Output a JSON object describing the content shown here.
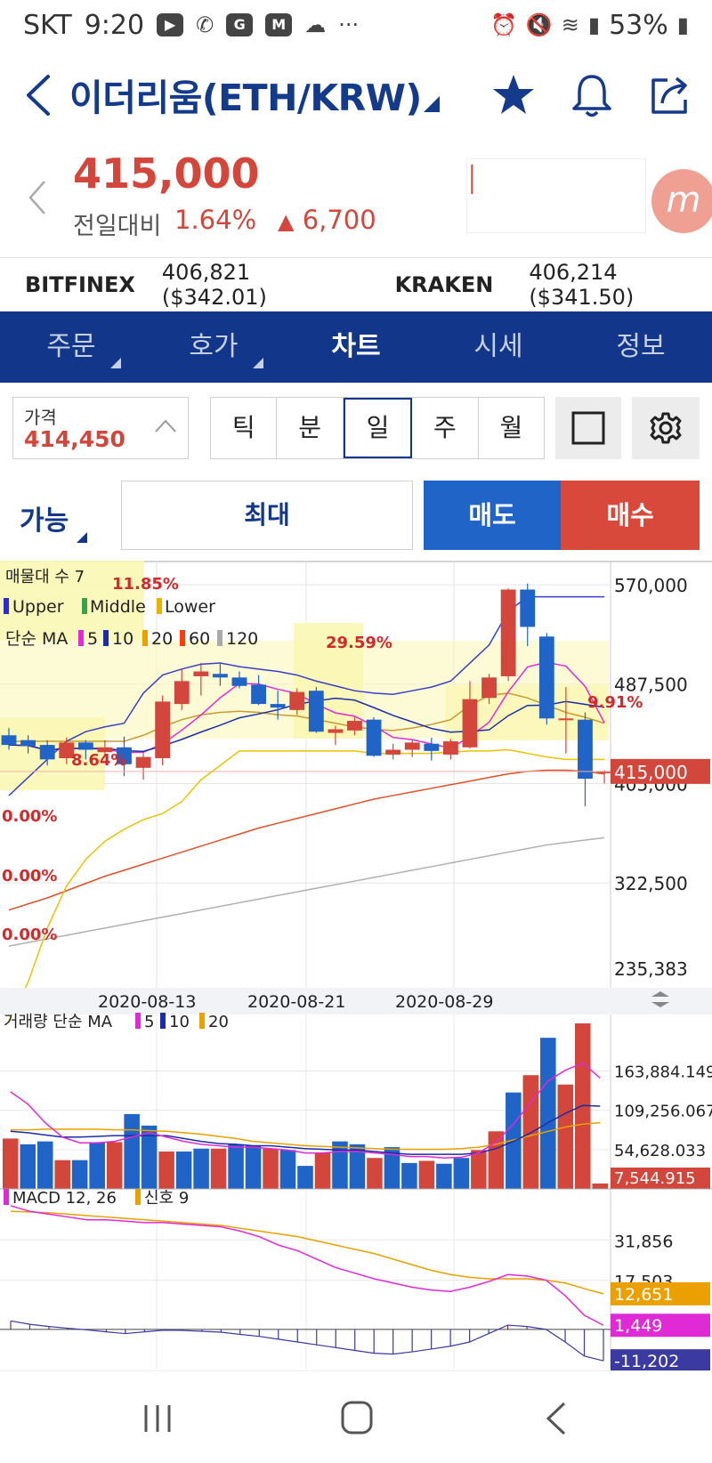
{
  "status_bar": {
    "carrier": "SKT",
    "time": "9:20",
    "battery": "53%"
  },
  "header": {
    "title": "이더리움(ETH/KRW)"
  },
  "price": {
    "current": "415,000",
    "change_label": "전일대비",
    "change_pct": "1.64%",
    "change_val": "6,700",
    "logo_letter": "m"
  },
  "exchanges": [
    {
      "name": "BITFINEX",
      "value": "406,821 ($342.01)"
    },
    {
      "name": "KRAKEN",
      "value": "406,214 ($341.50)"
    }
  ],
  "tabs": [
    "주문",
    "호가",
    "차트",
    "시세",
    "정보"
  ],
  "price_box": {
    "label": "가격",
    "value": "414,450"
  },
  "periods": [
    "틱",
    "분",
    "일",
    "주",
    "월"
  ],
  "order": {
    "available": "가능",
    "max": "최대",
    "sell": "매도",
    "buy": "매수"
  },
  "colors": {
    "brand": "#12378a",
    "up": "#d2463b",
    "down": "#2064c7",
    "sell": "#2064c7",
    "buy": "#d8493c"
  },
  "chart_data": [
    {
      "type": "candlestick",
      "title": "",
      "indicators": {
        "volume_profile": "매물대 수 7",
        "bollinger": [
          "Upper",
          "Middle",
          "Lower"
        ],
        "ma_label": "단순 MA",
        "ma_periods": [
          "5",
          "10",
          "20",
          "60",
          "120"
        ]
      },
      "y_ticks": [
        "570,000",
        "487,500",
        "405,000",
        "322,500",
        "235,383"
      ],
      "current_price_label": "415,000",
      "x_ticks": [
        "2020-08-13",
        "2020-08-21",
        "2020-08-29"
      ],
      "volume_profile_pcts": [
        "11.85%",
        "29.59%",
        "9.91%",
        "8.64%",
        "0.00%",
        "0.00%",
        "0.00%"
      ],
      "ohlc": [
        [
          445000,
          451000,
          433000,
          437000
        ],
        [
          441000,
          445000,
          430000,
          436000
        ],
        [
          437000,
          441000,
          420000,
          425000
        ],
        [
          426000,
          443000,
          421000,
          439000
        ],
        [
          439000,
          441000,
          425000,
          433000
        ],
        [
          431000,
          441000,
          428000,
          435000
        ],
        [
          435000,
          444000,
          411000,
          421000
        ],
        [
          418000,
          431000,
          408000,
          427000
        ],
        [
          426000,
          478000,
          420000,
          473000
        ],
        [
          471000,
          500000,
          466000,
          490000
        ],
        [
          494000,
          505000,
          478000,
          498000
        ],
        [
          496000,
          505000,
          486000,
          493000
        ],
        [
          493000,
          498000,
          484000,
          486000
        ],
        [
          487000,
          495000,
          470000,
          471000
        ],
        [
          471000,
          482000,
          458000,
          468000
        ],
        [
          466000,
          484000,
          462000,
          481000
        ],
        [
          482000,
          485000,
          447000,
          448000
        ],
        [
          447000,
          453000,
          437000,
          450000
        ],
        [
          449000,
          460000,
          445000,
          457000
        ],
        [
          458000,
          460000,
          427000,
          428000
        ],
        [
          429000,
          438000,
          425000,
          433000
        ],
        [
          433000,
          441000,
          427000,
          439000
        ],
        [
          438000,
          443000,
          424000,
          432000
        ],
        [
          429000,
          442000,
          425000,
          440000
        ],
        [
          435000,
          490000,
          434000,
          475000
        ],
        [
          476000,
          496000,
          471000,
          493000
        ],
        [
          494000,
          567000,
          490000,
          566000
        ],
        [
          566000,
          571000,
          519000,
          535000
        ],
        [
          527000,
          530000,
          454000,
          459000
        ],
        [
          458000,
          485000,
          430000,
          459000
        ],
        [
          458000,
          464000,
          386000,
          409000
        ],
        [
          414000,
          416000,
          405000,
          415000
        ]
      ],
      "bollinger_upper": [
        395000,
        410000,
        425000,
        440000,
        448000,
        452000,
        455000,
        480000,
        495000,
        500000,
        504000,
        505000,
        502000,
        500000,
        498000,
        495000,
        490000,
        486000,
        482000,
        480000,
        479000,
        482000,
        485000,
        490000,
        505000,
        520000,
        548000,
        560000,
        560000,
        560000,
        560000,
        560000
      ],
      "bollinger_middle": [
        440000,
        440000,
        440000,
        440000,
        440000,
        440000,
        440000,
        445000,
        452000,
        458000,
        462000,
        464000,
        465000,
        464000,
        462000,
        461000,
        458000,
        455000,
        452000,
        450000,
        449000,
        451000,
        454000,
        458000,
        470000,
        478000,
        480000,
        476000,
        470000,
        464000,
        460000,
        455000
      ],
      "bollinger_lower": [
        208000,
        240000,
        285000,
        320000,
        342000,
        357000,
        367000,
        375000,
        380000,
        390000,
        408000,
        420000,
        432000,
        432000,
        432000,
        432000,
        432000,
        432000,
        432000,
        430000,
        430000,
        430000,
        430000,
        431000,
        432000,
        432000,
        433000,
        430000,
        427000,
        425000,
        425000,
        425000
      ],
      "ma_red": [
        300000,
        305000,
        310000,
        316000,
        322000,
        328000,
        333000,
        338000,
        343000,
        348000,
        353000,
        358000,
        363000,
        368000,
        372000,
        376000,
        380000,
        384000,
        388000,
        392000,
        395000,
        398000,
        401000,
        404000,
        407000,
        410000,
        413000,
        415000,
        416000,
        416000,
        415000,
        413000
      ],
      "ma_gray": [
        270000,
        273000,
        276000,
        279000,
        282000,
        285000,
        288000,
        291000,
        294000,
        297000,
        300000,
        303000,
        306000,
        309000,
        312000,
        315000,
        318000,
        321000,
        324000,
        327000,
        330000,
        333000,
        336000,
        339000,
        342000,
        345000,
        348000,
        351000,
        354000,
        356000,
        358000,
        360000
      ]
    },
    {
      "type": "bar",
      "title": "",
      "legend_label": "거래량 단순 MA",
      "ma_periods": [
        "5",
        "10",
        "20"
      ],
      "y_ticks": [
        "163,884.149",
        "109,256.067",
        "54,628.033"
      ],
      "last_value_label": "7,544.915",
      "values": [
        70000,
        62000,
        66000,
        40000,
        40000,
        65000,
        65000,
        104000,
        88000,
        52000,
        52000,
        56000,
        56000,
        62000,
        60000,
        56000,
        54000,
        32000,
        50000,
        66000,
        62000,
        43000,
        58000,
        36000,
        39000,
        35000,
        43000,
        54000,
        80000,
        134000,
        158000,
        210000,
        145000,
        230000,
        7544.915
      ],
      "ma5": [
        135000,
        118000,
        92000,
        72000,
        64000,
        64000,
        66000,
        72000,
        78000,
        72000,
        66000,
        62000,
        60000,
        58000,
        58000,
        56000,
        54000,
        50000,
        50000,
        52000,
        52000,
        50000,
        48000,
        45000,
        45000,
        43000,
        44000,
        50000,
        65000,
        90000,
        120000,
        150000,
        165000,
        175000,
        154000
      ],
      "ma10": [
        80000,
        78000,
        75000,
        72000,
        72000,
        73000,
        74000,
        74000,
        74000,
        74000,
        70000,
        66000,
        63000,
        62000,
        60000,
        60000,
        58000,
        56000,
        55000,
        54000,
        54000,
        52000,
        50000,
        48000,
        48000,
        48000,
        48000,
        50000,
        56000,
        66000,
        78000,
        92000,
        105000,
        116000,
        115000
      ],
      "ma20": [
        82000,
        82000,
        83000,
        83000,
        83000,
        83000,
        82000,
        82000,
        81000,
        80000,
        78000,
        76000,
        73000,
        70000,
        66000,
        64000,
        62000,
        60000,
        59000,
        58000,
        57000,
        56000,
        55000,
        55000,
        55000,
        55000,
        56000,
        58000,
        62000,
        68000,
        74000,
        80000,
        86000,
        90000,
        92000
      ]
    },
    {
      "type": "line",
      "title": "",
      "legend_label": "MACD 12, 26",
      "signal_label": "신호 9",
      "y_ticks": [
        "31,856",
        "17,503"
      ],
      "value_labels": [
        "12,651",
        "1,449",
        "-11,202"
      ],
      "macd": [
        44000,
        42000,
        41000,
        40000,
        39000,
        39000,
        38500,
        38000,
        38000,
        37500,
        37000,
        36500,
        35000,
        33000,
        30000,
        28000,
        25000,
        22000,
        20000,
        18000,
        16500,
        15000,
        14000,
        13500,
        15000,
        17000,
        19500,
        19000,
        17500,
        12000,
        5000,
        1449
      ],
      "signal": [
        42000,
        41800,
        41500,
        41000,
        40500,
        40000,
        39500,
        39000,
        38500,
        38000,
        37500,
        37000,
        36000,
        35000,
        34000,
        33000,
        31500,
        30000,
        28500,
        27000,
        25000,
        23000,
        21000,
        19500,
        18500,
        18000,
        18000,
        18000,
        17500,
        16500,
        14500,
        12651
      ],
      "oscillator": [
        3000,
        1800,
        1000,
        400,
        -200,
        -900,
        -1500,
        -900,
        -300,
        -400,
        -700,
        -1000,
        -1800,
        -2500,
        -3500,
        -4500,
        -5500,
        -6500,
        -7500,
        -8500,
        -8800,
        -8000,
        -7000,
        -6000,
        -4500,
        -1500,
        1500,
        1000,
        0,
        -4500,
        -9500,
        -11202
      ]
    }
  ],
  "icons": [
    "back-icon",
    "star-icon",
    "bell-icon",
    "share-icon",
    "chevron-left-icon",
    "chevron-up-icon",
    "square-icon",
    "gear-icon",
    "recents-icon",
    "home-icon",
    "nav-back-icon"
  ]
}
